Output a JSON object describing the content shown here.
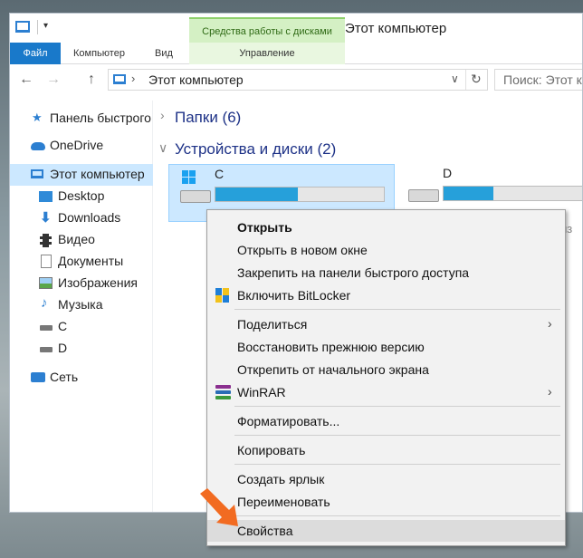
{
  "quick_access_toolbar": {
    "dropdown_glyph": "▾"
  },
  "contextual_tab": {
    "header": "Средства работы с дисками",
    "tab": "Управление"
  },
  "window": {
    "title": "Этот компьютер"
  },
  "ribbon": {
    "tabs": [
      "Файл",
      "Компьютер",
      "Вид"
    ]
  },
  "nav": {
    "back": "←",
    "forward": "→",
    "up": "↑",
    "address_chevron": "›",
    "address_text": "Этот компьютер",
    "address_dropdown": "∨",
    "refresh": "↻",
    "search_placeholder": "Поиск: Этот компьютер"
  },
  "sidebar": {
    "items": [
      {
        "label": "Панель быстрого доступа",
        "icon": "star-icon"
      },
      {
        "label": "OneDrive",
        "icon": "cloud-icon"
      },
      {
        "label": "Этот компьютер",
        "icon": "computer-icon",
        "selected": true
      },
      {
        "label": "Desktop",
        "icon": "desktop-icon"
      },
      {
        "label": "Downloads",
        "icon": "download-icon"
      },
      {
        "label": "Видео",
        "icon": "video-icon"
      },
      {
        "label": "Документы",
        "icon": "documents-icon"
      },
      {
        "label": "Изображения",
        "icon": "pictures-icon"
      },
      {
        "label": "Музыка",
        "icon": "music-icon"
      },
      {
        "label": "C",
        "icon": "drive-icon"
      },
      {
        "label": "D",
        "icon": "drive-icon"
      },
      {
        "label": "Сеть",
        "icon": "network-icon"
      }
    ]
  },
  "content": {
    "collapsed_glyph": "›",
    "expanded_glyph": "∨",
    "folders_group": "Папки (6)",
    "devices_group": "Устройства и диски (2)",
    "drives": [
      {
        "name": "C",
        "used_fraction": 0.49,
        "selected": true
      },
      {
        "name": "D",
        "used_fraction": 0.35,
        "selected": false,
        "free_text": "из"
      }
    ]
  },
  "context_menu": {
    "submenu_arrow": "›",
    "items": [
      "Открыть",
      "Открыть в новом окне",
      "Закрепить на панели быстрого доступа",
      "Включить BitLocker",
      "Поделиться",
      "Восстановить прежнюю версию",
      "Открепить от начального экрана",
      "WinRAR",
      "Форматировать...",
      "Копировать",
      "Создать ярлык",
      "Переименовать",
      "Свойства"
    ]
  },
  "colors": {
    "accent": "#1979ca",
    "selection": "#cce8ff",
    "drive_fill": "#26a0da",
    "pointer": "#f26b21"
  }
}
